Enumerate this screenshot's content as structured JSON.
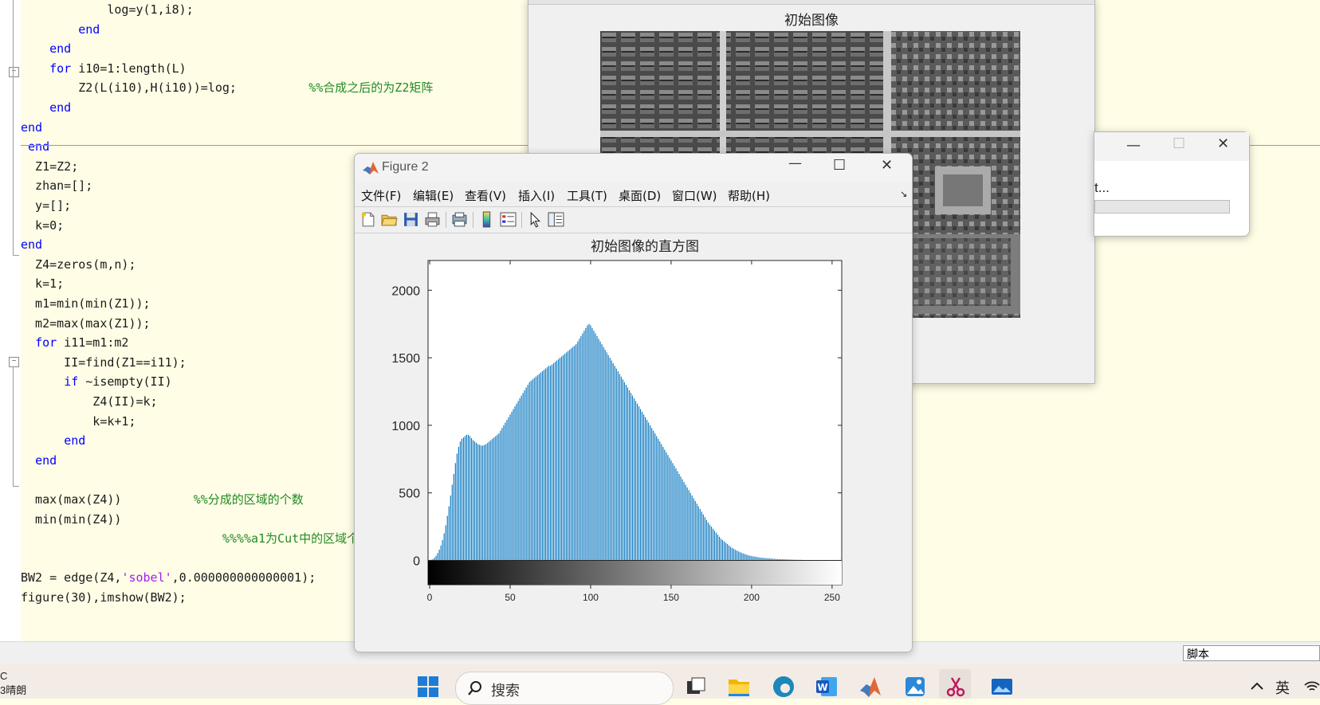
{
  "editor": {
    "lines": [
      {
        "pre": "            log=y(1,i8);"
      },
      {
        "pre": "        ",
        "kw": "end"
      },
      {
        "pre": "    ",
        "kw": "end"
      },
      {
        "pre": "    ",
        "kw": "for",
        "post": " i10=1:length(L)"
      },
      {
        "pre": "        Z2(L(i10),H(i10))=log;          ",
        "cm": "%%合成之后的为Z2矩阵"
      },
      {
        "pre": "    ",
        "kw": "end"
      },
      {
        "pre": "",
        "kw": "end"
      },
      {
        "pre": " ",
        "kw": "end"
      },
      {
        "pre": "  Z1=Z2;"
      },
      {
        "pre": "  zhan=[];"
      },
      {
        "pre": "  y=[];"
      },
      {
        "pre": "  k=0;"
      },
      {
        "pre": "",
        "kw": "end"
      },
      {
        "pre": "  Z4=zeros(m,n);"
      },
      {
        "pre": "  k=1;"
      },
      {
        "pre": "  m1=min(min(Z1));"
      },
      {
        "pre": "  m2=max(max(Z1));"
      },
      {
        "pre": "  ",
        "kw": "for",
        "post": " i11=m1:m2"
      },
      {
        "pre": "      II=find(Z1==i11);"
      },
      {
        "pre": "      ",
        "kw": "if",
        "post": " ~isempty(II)"
      },
      {
        "pre": "          Z4(II)=k;"
      },
      {
        "pre": "          k=k+1;"
      },
      {
        "pre": "      ",
        "kw": "end"
      },
      {
        "pre": "  ",
        "kw": "end"
      },
      {
        "pre": ""
      },
      {
        "pre": "  max(max(Z4))          ",
        "cm": "%%分成的区域的个数"
      },
      {
        "pre": "  min(min(Z4))"
      },
      {
        "pre": "                            ",
        "cm": "%%%%a1为Cut中的区域个"
      },
      {
        "pre": ""
      },
      {
        "pre": "BW2 = edge(Z4,",
        "str": "'sobel'",
        "post": ",0.000000000000001);"
      },
      {
        "pre": "figure(30),imshow(BW2);"
      }
    ],
    "status_label": "脚本"
  },
  "figure1": {
    "plot_title": "初始图像"
  },
  "progress_window": {
    "text": "t...",
    "progress": 0
  },
  "figure2": {
    "window_title": "Figure 2",
    "menu": [
      "文件(F)",
      "编辑(E)",
      "查看(V)",
      "插入(I)",
      "工具(T)",
      "桌面(D)",
      "窗口(W)",
      "帮助(H)"
    ],
    "toolbar_icons": [
      "new-file-icon",
      "open-folder-icon",
      "save-icon",
      "print-icon",
      "print-preview-icon",
      "colorbar-icon",
      "legend-icon",
      "pointer-icon",
      "property-editor-icon"
    ]
  },
  "chart_data": {
    "type": "bar",
    "title": "初始图像的直方图",
    "xlabel": "",
    "ylabel": "",
    "xlim": [
      0,
      255
    ],
    "ylim": [
      -180,
      2220
    ],
    "xticks": [
      0,
      50,
      100,
      150,
      200,
      250
    ],
    "yticks": [
      0,
      500,
      1000,
      1500,
      2000
    ],
    "bar_color": "#0072bd",
    "colorbar": "grayscale gradient black to white beneath x-axis",
    "series": [
      {
        "values": [
          2,
          5,
          10,
          20,
          35,
          55,
          80,
          110,
          150,
          200,
          260,
          330,
          400,
          480,
          560,
          640,
          720,
          790,
          840,
          880,
          900,
          910,
          920,
          930,
          930,
          920,
          905,
          890,
          880,
          870,
          860,
          855,
          850,
          850,
          855,
          860,
          870,
          880,
          890,
          900,
          910,
          920,
          930,
          940,
          960,
          980,
          1000,
          1020,
          1040,
          1060,
          1080,
          1100,
          1120,
          1140,
          1160,
          1180,
          1200,
          1220,
          1240,
          1260,
          1280,
          1300,
          1320,
          1330,
          1340,
          1350,
          1360,
          1370,
          1380,
          1390,
          1400,
          1410,
          1420,
          1430,
          1440,
          1440,
          1450,
          1460,
          1470,
          1480,
          1490,
          1500,
          1510,
          1520,
          1530,
          1540,
          1550,
          1560,
          1570,
          1580,
          1590,
          1600,
          1620,
          1640,
          1660,
          1680,
          1700,
          1720,
          1740,
          1750,
          1740,
          1720,
          1700,
          1680,
          1660,
          1640,
          1620,
          1600,
          1580,
          1560,
          1540,
          1520,
          1500,
          1480,
          1460,
          1440,
          1420,
          1400,
          1380,
          1360,
          1340,
          1320,
          1300,
          1280,
          1260,
          1240,
          1220,
          1200,
          1180,
          1160,
          1140,
          1120,
          1100,
          1080,
          1060,
          1040,
          1020,
          1000,
          980,
          960,
          940,
          920,
          900,
          880,
          860,
          840,
          820,
          800,
          780,
          760,
          740,
          720,
          700,
          680,
          660,
          640,
          620,
          600,
          580,
          560,
          540,
          520,
          500,
          480,
          460,
          440,
          420,
          400,
          380,
          360,
          340,
          320,
          300,
          280,
          265,
          250,
          235,
          220,
          205,
          190,
          175,
          160,
          150,
          140,
          130,
          120,
          110,
          100,
          92,
          85,
          78,
          72,
          66,
          60,
          55,
          50,
          46,
          42,
          38,
          35,
          32,
          30,
          28,
          26,
          24,
          22,
          20,
          19,
          18,
          17,
          16,
          15,
          14,
          13,
          12,
          11,
          10,
          10,
          9,
          9,
          8,
          8,
          7,
          7,
          6,
          6,
          5,
          5,
          5,
          4,
          4,
          4,
          3,
          3,
          3,
          3,
          2,
          2,
          2,
          2,
          2,
          1,
          1,
          1,
          1,
          1,
          1,
          1,
          1,
          1,
          1,
          1,
          0,
          0,
          0,
          0,
          0,
          0,
          0,
          0,
          0,
          0,
          0,
          0,
          0,
          0,
          0,
          0,
          0,
          0,
          0,
          0,
          0,
          0,
          0,
          0,
          0,
          0,
          0,
          0,
          0
        ]
      }
    ]
  },
  "taskbar": {
    "weather": "C\n3晴朗",
    "search_placeholder": "搜索",
    "tray_text": "英",
    "icons": [
      "windows-start-icon",
      "search-icon",
      "task-view-icon",
      "file-explorer-icon",
      "edge-browser-icon",
      "word-icon",
      "matlab-icon",
      "photos-icon",
      "snipping-tool-icon",
      "gallery-icon",
      "chevron-up-icon",
      "wifi-icon"
    ]
  }
}
